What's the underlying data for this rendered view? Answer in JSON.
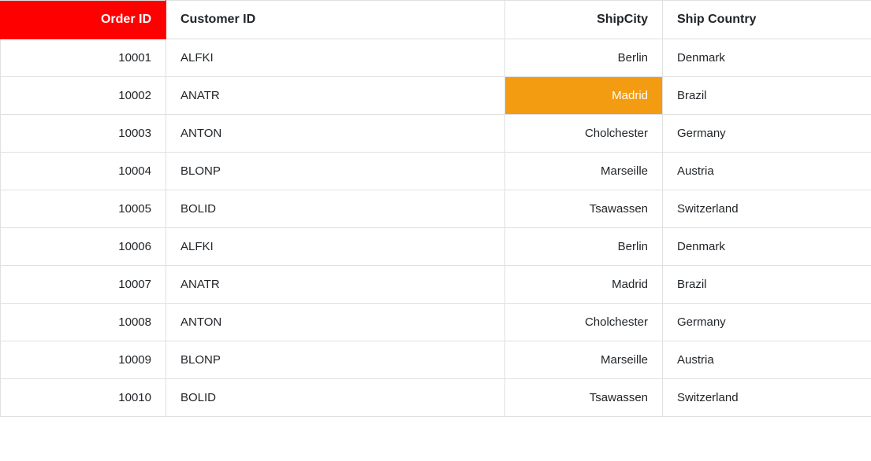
{
  "columns": {
    "orderid": {
      "label": "Order ID"
    },
    "customerid": {
      "label": "Customer ID"
    },
    "shipcity": {
      "label": "ShipCity"
    },
    "shipcountry": {
      "label": "Ship Country"
    }
  },
  "highlight_cell": {
    "row": 1,
    "col": "shipcity"
  },
  "rows": [
    {
      "orderid": "10001",
      "customerid": "ALFKI",
      "shipcity": "Berlin",
      "shipcountry": "Denmark"
    },
    {
      "orderid": "10002",
      "customerid": "ANATR",
      "shipcity": "Madrid",
      "shipcountry": "Brazil"
    },
    {
      "orderid": "10003",
      "customerid": "ANTON",
      "shipcity": "Cholchester",
      "shipcountry": "Germany"
    },
    {
      "orderid": "10004",
      "customerid": "BLONP",
      "shipcity": "Marseille",
      "shipcountry": "Austria"
    },
    {
      "orderid": "10005",
      "customerid": "BOLID",
      "shipcity": "Tsawassen",
      "shipcountry": "Switzerland"
    },
    {
      "orderid": "10006",
      "customerid": "ALFKI",
      "shipcity": "Berlin",
      "shipcountry": "Denmark"
    },
    {
      "orderid": "10007",
      "customerid": "ANATR",
      "shipcity": "Madrid",
      "shipcountry": "Brazil"
    },
    {
      "orderid": "10008",
      "customerid": "ANTON",
      "shipcity": "Cholchester",
      "shipcountry": "Germany"
    },
    {
      "orderid": "10009",
      "customerid": "BLONP",
      "shipcity": "Marseille",
      "shipcountry": "Austria"
    },
    {
      "orderid": "10010",
      "customerid": "BOLID",
      "shipcity": "Tsawassen",
      "shipcountry": "Switzerland"
    }
  ]
}
